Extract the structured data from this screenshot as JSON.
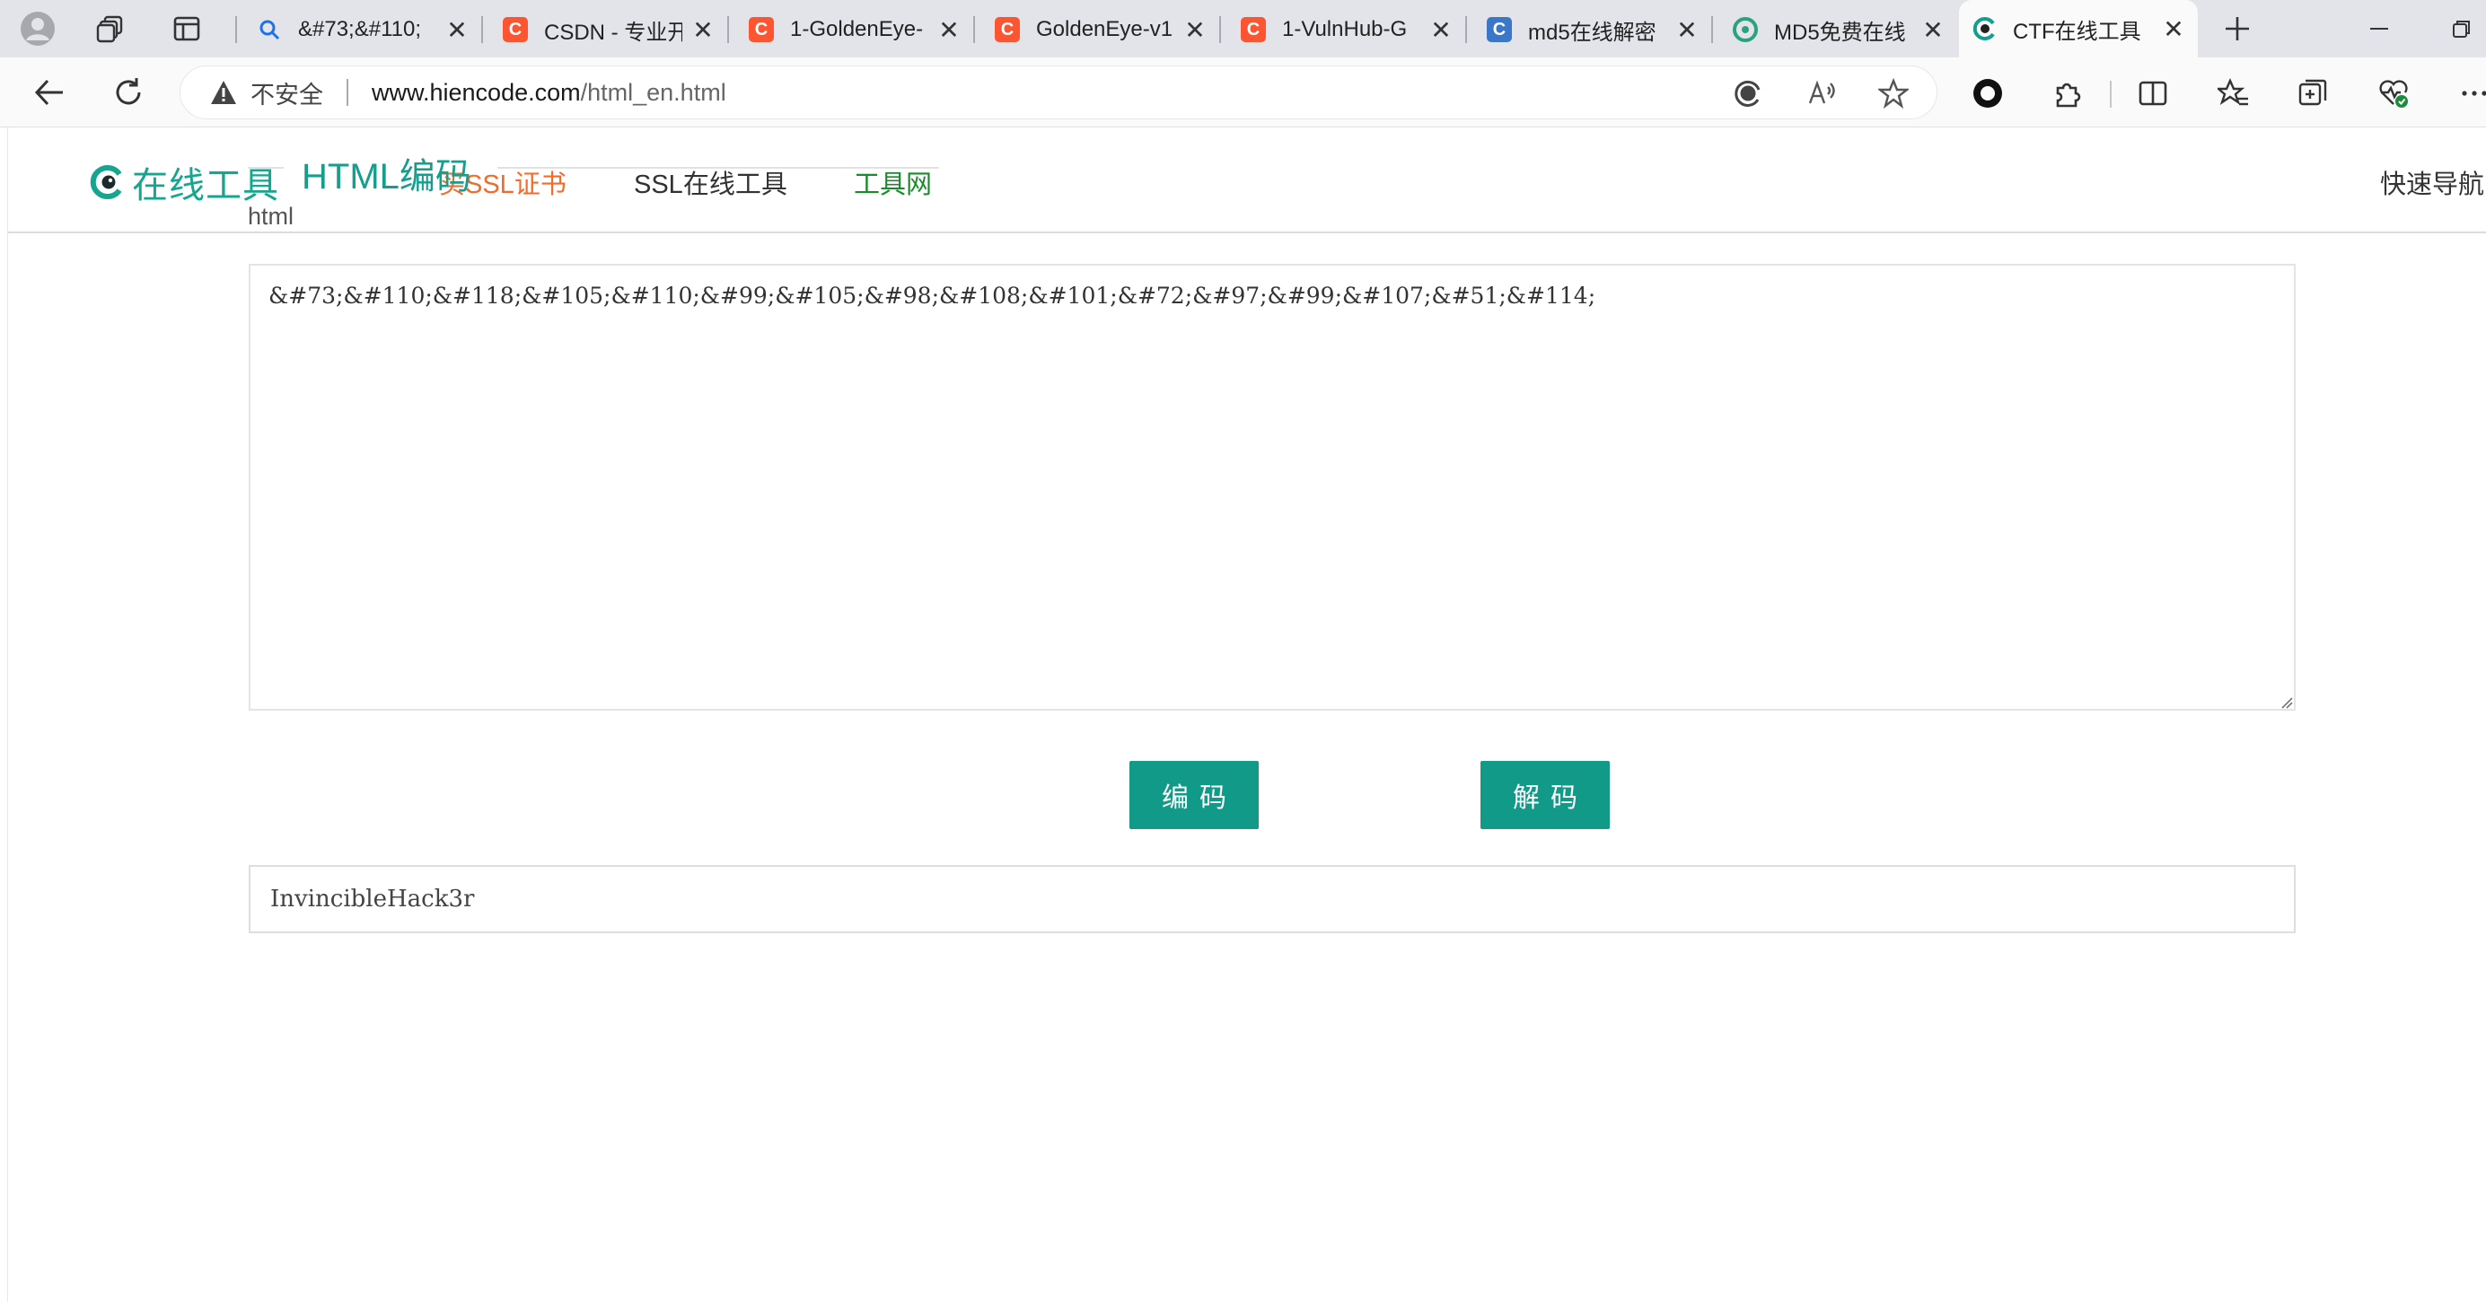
{
  "browser": {
    "tabs": [
      {
        "title": "&#73;&#110;",
        "favicon": "search-icon",
        "color": "#1a73e8"
      },
      {
        "title": "CSDN - 专业开",
        "favicon": "csdn-icon",
        "color": "#fc5531"
      },
      {
        "title": "1-GoldenEye-",
        "favicon": "csdn-icon",
        "color": "#fc5531"
      },
      {
        "title": "GoldenEye-v1",
        "favicon": "csdn-icon",
        "color": "#fc5531"
      },
      {
        "title": "1-VulnHub-G",
        "favicon": "csdn-icon",
        "color": "#fc5531"
      },
      {
        "title": "md5在线解密",
        "favicon": "cmd5-icon",
        "color": "#3a77c8"
      },
      {
        "title": "MD5免费在线",
        "favicon": "md5-site-icon",
        "color": "#2aa37d"
      },
      {
        "title": "CTF在线工具",
        "favicon": "hiencode-icon",
        "color": "#139e8e",
        "active": true
      }
    ],
    "address": {
      "security_label": "不安全",
      "url_host": "www.hiencode.com",
      "url_path": "/html_en.html"
    }
  },
  "site": {
    "logo_text": "在线工具",
    "nav": {
      "ssl_buy": "买SSL证书",
      "ssl_tools": "SSL在线工具",
      "tools_net": "工具网",
      "quick_nav": "快速导航"
    },
    "colors": {
      "accent": "#119a88",
      "nav_orange": "#f26b2a",
      "nav_green": "#1b8a2a"
    }
  },
  "tool": {
    "title": "HTML编码",
    "subtitle": "html",
    "input_value": "&#73;&#110;&#118;&#105;&#110;&#99;&#105;&#98;&#108;&#101;&#72;&#97;&#99;&#107;&#51;&#114;",
    "encode_label": "编码",
    "decode_label": "解码",
    "output_value": "InvincibleHack3r"
  }
}
